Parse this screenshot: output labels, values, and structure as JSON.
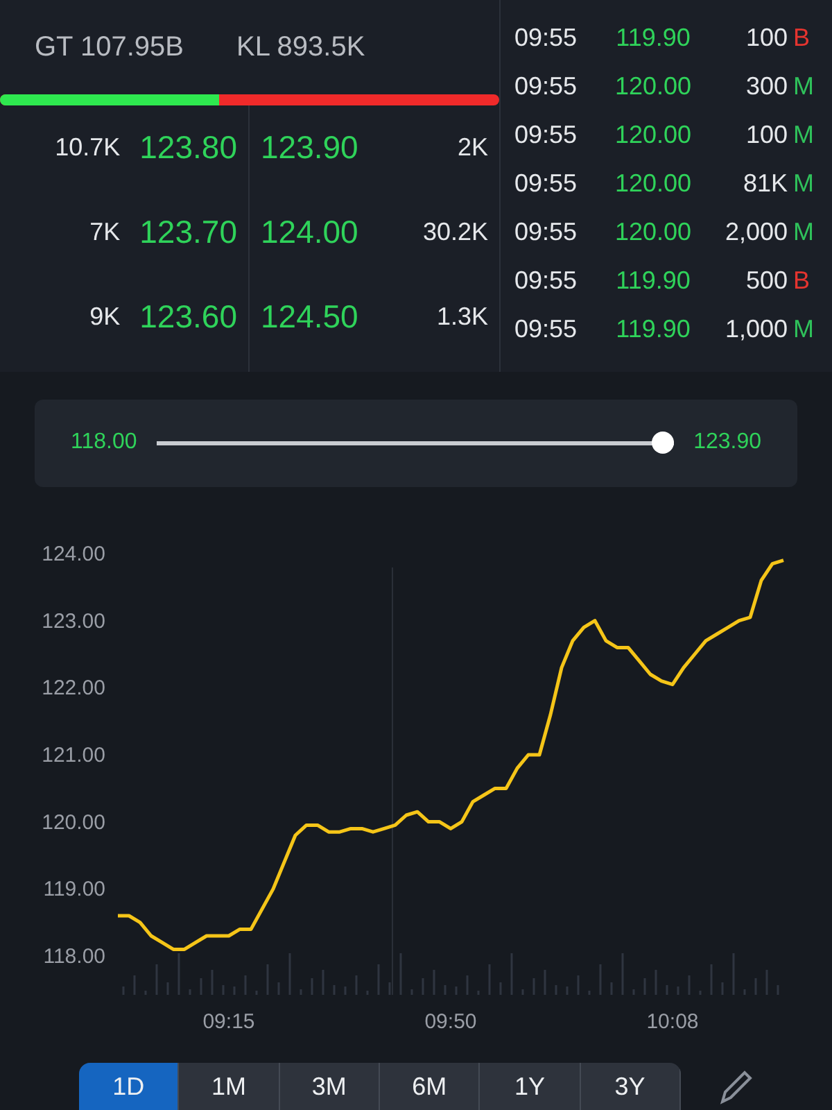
{
  "summary": {
    "value_label": "GT",
    "value": "107.95B",
    "volume_label": "KL",
    "volume": "893.5K"
  },
  "ratio_bar": {
    "level": 0.44
  },
  "order_book": [
    {
      "bid_volume": "10.7K",
      "bid_price": "123.80",
      "ask_price": "123.90",
      "ask_volume": "2K"
    },
    {
      "bid_volume": "7K",
      "bid_price": "123.70",
      "ask_price": "124.00",
      "ask_volume": "30.2K"
    },
    {
      "bid_volume": "9K",
      "bid_price": "123.60",
      "ask_price": "124.50",
      "ask_volume": "1.3K"
    }
  ],
  "trades": [
    {
      "time": "09:55",
      "price": "119.90",
      "volume": "100",
      "side": "B",
      "color": "#e5342f"
    },
    {
      "time": "09:55",
      "price": "120.00",
      "volume": "300",
      "side": "M",
      "color": "#2fc25b"
    },
    {
      "time": "09:55",
      "price": "120.00",
      "volume": "100",
      "side": "M",
      "color": "#2fc25b"
    },
    {
      "time": "09:55",
      "price": "120.00",
      "volume": "81K",
      "side": "M",
      "color": "#2fc25b"
    },
    {
      "time": "09:55",
      "price": "120.00",
      "volume": "2,000",
      "side": "M",
      "color": "#2fc25b"
    },
    {
      "time": "09:55",
      "price": "119.90",
      "volume": "500",
      "side": "B",
      "color": "#e5342f"
    },
    {
      "time": "09:55",
      "price": "119.90",
      "volume": "1,000",
      "side": "M",
      "color": "#2fc25b"
    }
  ],
  "range_slider": {
    "low": "118.00",
    "high": "123.90",
    "level": 1
  },
  "price_chart": {
    "time_labels": [
      "09:15",
      "09:50",
      "10:08"
    ],
    "chart_data": {
      "type": "line",
      "ylim": [
        118,
        124
      ],
      "yticks": [
        {
          "value": 124,
          "label": "124.00"
        },
        {
          "value": 123,
          "label": "123.00"
        },
        {
          "value": 122,
          "label": "122.00"
        },
        {
          "value": 121,
          "label": "121.00"
        },
        {
          "value": 120,
          "label": "120.00"
        },
        {
          "value": 119,
          "label": "119.00"
        },
        {
          "value": 118,
          "label": "118.00"
        }
      ],
      "series": [
        {
          "color": "#f5c518",
          "values": [
            118.6,
            118.6,
            118.5,
            118.3,
            118.2,
            118.1,
            118.1,
            118.2,
            118.3,
            118.3,
            118.3,
            118.4,
            118.4,
            118.7,
            119.0,
            119.4,
            119.8,
            119.95,
            119.95,
            119.85,
            119.85,
            119.9,
            119.9,
            119.85,
            119.9,
            119.95,
            120.1,
            120.15,
            120.0,
            120.0,
            119.9,
            120.0,
            120.3,
            120.4,
            120.5,
            120.5,
            120.8,
            121.0,
            121.0,
            121.6,
            122.3,
            122.7,
            122.9,
            123.0,
            122.7,
            122.6,
            122.6,
            122.4,
            122.2,
            122.1,
            122.05,
            122.3,
            122.5,
            122.7,
            122.8,
            122.9,
            123.0,
            123.05,
            123.6,
            123.85,
            123.9
          ]
        }
      ]
    }
  },
  "periods": [
    {
      "label": "1D",
      "selected": true
    },
    {
      "label": "1M",
      "selected": false
    },
    {
      "label": "3M",
      "selected": false
    },
    {
      "label": "6M",
      "selected": false
    },
    {
      "label": "1Y",
      "selected": false
    },
    {
      "label": "3Y",
      "selected": false
    }
  ]
}
